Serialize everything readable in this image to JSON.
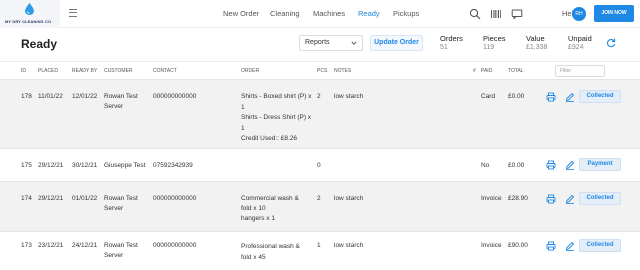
{
  "brand": {
    "name": "MY DRY CLEANING CO"
  },
  "nav": [
    {
      "label": "New Order",
      "active": false
    },
    {
      "label": "Cleaning",
      "active": false
    },
    {
      "label": "Machines",
      "active": false
    },
    {
      "label": "Ready",
      "active": true
    },
    {
      "label": "Pickups",
      "active": false
    }
  ],
  "topbar": {
    "help_label": "Help",
    "avatar_initials": "RH",
    "join_label": "JOIN NOW"
  },
  "page": {
    "title": "Ready",
    "reports_select": "Reports",
    "update_label": "Update Order"
  },
  "stats": {
    "orders": {
      "label": "Orders",
      "value": "51"
    },
    "pieces": {
      "label": "Pieces",
      "value": "119"
    },
    "value": {
      "label": "Value",
      "value": "£1,338"
    },
    "unpaid": {
      "label": "Unpaid",
      "value": "£924"
    }
  },
  "table": {
    "headers": {
      "id": "ID",
      "placed": "PLACED",
      "ready_by": "READY BY",
      "customer": "CUSTOMER",
      "contact": "CONTACT",
      "order": "ORDER",
      "pcs": "PCS",
      "notes": "NOTES",
      "hash": "#",
      "paid": "PAID",
      "total": "TOTAL"
    },
    "filter_placeholder": "Filter",
    "rows": [
      {
        "id": "178",
        "placed": "11/01/22",
        "ready_by": "12/01/22",
        "customer": [
          "Rowan Test",
          "Server"
        ],
        "contact": "000000000000",
        "order": [
          "Shirts - Boxed shirt (P) x",
          "1",
          "Shirts - Dress Shirt (P) x",
          "1",
          "Credit Used:: £8.26"
        ],
        "pcs": "2",
        "notes": "low starch",
        "paid": "Card",
        "total": "£0.00",
        "status": "Collected"
      },
      {
        "id": "175",
        "placed": "29/12/21",
        "ready_by": "30/12/21",
        "customer": [
          "Giuseppe Test"
        ],
        "contact": "07592342939",
        "order": [],
        "pcs": "0",
        "notes": "",
        "paid": "No",
        "total": "£0.00",
        "status": "Payment"
      },
      {
        "id": "174",
        "placed": "29/12/21",
        "ready_by": "01/01/22",
        "customer": [
          "Rowan Test",
          "Server"
        ],
        "contact": "000000000000",
        "order": [
          "Commercial wash &",
          "fold x 10",
          "hangers x 1"
        ],
        "pcs": "2",
        "notes": "low starch",
        "paid": "Invoice",
        "total": "£28.90",
        "status": "Collected"
      },
      {
        "id": "173",
        "placed": "23/12/21",
        "ready_by": "24/12/21",
        "customer": [
          "Rowan Test",
          "Server"
        ],
        "contact": "000000000000",
        "order": [
          "Professional wash &",
          "fold x 45"
        ],
        "pcs": "1",
        "notes": "low starch",
        "paid": "Invoice",
        "total": "£90.00",
        "status": "Collected"
      }
    ]
  },
  "colors": {
    "accent": "#1e88e5",
    "row_shade": "#f2f2f2"
  },
  "icons": [
    "hamburger-icon",
    "search-icon",
    "barcode-icon",
    "message-icon",
    "chevron-down-icon",
    "refresh-icon",
    "print-icon",
    "edit-icon"
  ]
}
